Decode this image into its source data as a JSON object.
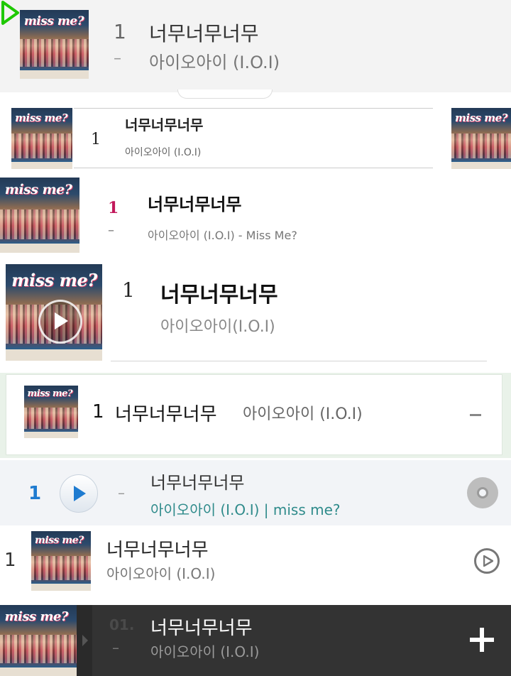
{
  "album": {
    "logo_main": "miss",
    "logo_sep": "me?",
    "logo_full": "miss me?"
  },
  "rows": [
    {
      "rank": "1",
      "change": "–",
      "title": "너무너무너무",
      "artist": "아이오아이 (I.O.I)",
      "action_icon": "play-triangle-icon",
      "accent": "#1ec800"
    },
    {
      "rank": "1",
      "title": "너무너무너무",
      "artist": "아이오아이 (I.O.I)"
    },
    {
      "rank": "1",
      "change": "–",
      "title": "너무너무너무",
      "artist": "아이오아이 (I.O.I) - Miss Me?",
      "accent": "#c2185b"
    },
    {
      "rank": "1",
      "title": "너무너무너무",
      "artist": "아이오아이(I.O.I)"
    },
    {
      "rank": "1",
      "title": "너무너무너무",
      "artist": "아이오아이 (I.O.I)",
      "change": "–"
    },
    {
      "rank": "1",
      "change": "–",
      "title": "너무너무너무",
      "artist": "아이오아이 (I.O.I) | miss me?",
      "accent": "#1e7bd0",
      "action_icon": "cd-icon"
    },
    {
      "rank": "1",
      "title": "너무너무너무",
      "artist": "아이오아이 (I.O.I)",
      "action_icon": "play-circle-icon"
    },
    {
      "rank": "01.",
      "change": "–",
      "title": "너무너무너무",
      "artist": "아이오아이 (I.O.I)",
      "action_icon": "add-icon"
    }
  ]
}
